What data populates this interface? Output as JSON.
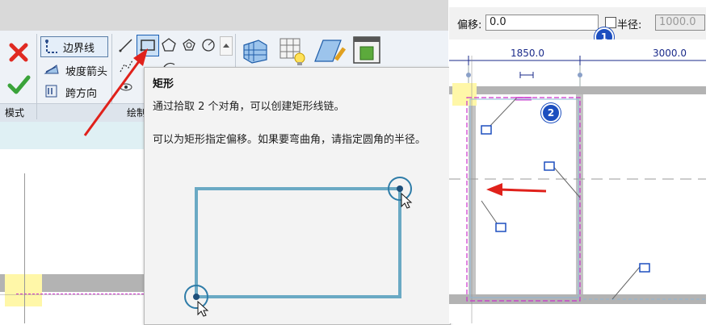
{
  "ribbon": {
    "boundary_line_label": "边界线",
    "slope_arrow_label": "坡度箭头",
    "span_direction_label": "跨方向",
    "mode_label": "模式",
    "draw_label": "绘制"
  },
  "tooltip": {
    "title": "矩形",
    "line1": "通过拾取 2 个对角，可以创建矩形线链。",
    "line2": "可以为矩形指定偏移。如果要弯曲角，请指定圆角的半径。"
  },
  "options_bar": {
    "offset_label": "偏移:",
    "offset_value": "0.0",
    "radius_label": "半径:",
    "radius_value": "1000.0",
    "radius_checked": false
  },
  "dimensions": {
    "dim1": "1850.0",
    "dim2": "3000.0"
  },
  "badges": {
    "badge1": "1",
    "badge2": "2"
  },
  "colors": {
    "arrow_red": "#e0211b",
    "boundary_magenta": "#cc33cc",
    "rect_preview": "#6aa9c4",
    "wall_gray": "#b3b3b3",
    "badge_blue": "#1d4fbf"
  }
}
